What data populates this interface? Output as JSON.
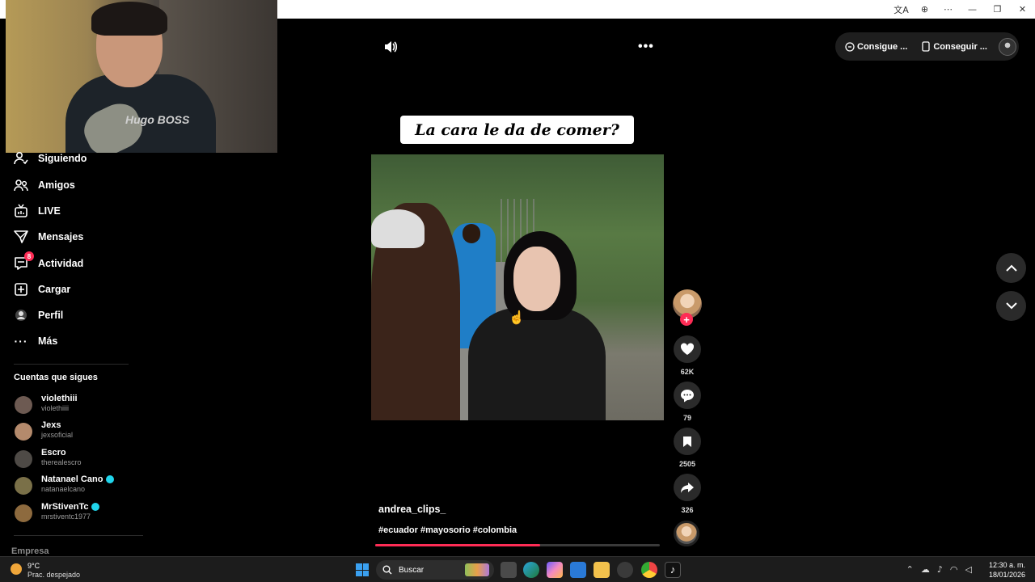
{
  "titlebar": {
    "icons": [
      "translate-icon",
      "zoom-icon",
      "more-icon",
      "minimize-icon",
      "restore-icon",
      "close-icon"
    ],
    "glyphs": [
      "a​A",
      "⊕",
      "⋯",
      "—",
      "❐",
      "✕"
    ]
  },
  "webcam": {
    "shirt_text": "Hugo BOSS"
  },
  "nav": {
    "items": [
      {
        "label": "Siguiendo",
        "icon": "following-icon"
      },
      {
        "label": "Amigos",
        "icon": "friends-icon"
      },
      {
        "label": "LIVE",
        "icon": "live-icon"
      },
      {
        "label": "Mensajes",
        "icon": "messages-icon"
      },
      {
        "label": "Actividad",
        "icon": "activity-icon",
        "badge": "8"
      },
      {
        "label": "Cargar",
        "icon": "upload-icon"
      },
      {
        "label": "Perfil",
        "icon": "profile-icon"
      },
      {
        "label": "Más",
        "icon": "more-icon"
      }
    ]
  },
  "following": {
    "title": "Cuentas que sigues",
    "accounts": [
      {
        "name": "violethiii",
        "handle": "violethiiii",
        "verified": false,
        "color": "#6d5a52"
      },
      {
        "name": "Jexs",
        "handle": "jexsoficial",
        "verified": false,
        "color": "#b48a6c"
      },
      {
        "name": "Escro",
        "handle": "therealescro",
        "verified": false,
        "color": "#4e4a46"
      },
      {
        "name": "Natanael Cano",
        "handle": "natanaelcano",
        "verified": true,
        "color": "#7a7048"
      },
      {
        "name": "MrStivenTc",
        "handle": "mrstiventc1977",
        "verified": true,
        "color": "#8d6a3e"
      }
    ]
  },
  "footer": {
    "empresa": "Empresa"
  },
  "topbar": {
    "get_coins": "Consigue ...",
    "get_app": "Conseguir ..."
  },
  "video": {
    "overlay_caption": "La cara le da de comer?",
    "username": "andrea_clips_",
    "hashtags": "#ecuador #mayosorio #colombia",
    "progress": 0.58
  },
  "actions": {
    "likes": "62K",
    "comments": "79",
    "saves": "2505",
    "shares": "326"
  },
  "taskbar": {
    "weather_temp": "9°C",
    "weather_desc": "Prac. despejado",
    "search_placeholder": "Buscar",
    "time": "12:30 a. m.",
    "date": "18/01/2026"
  },
  "colors": {
    "accent": "#fe2c55",
    "verified": "#20d5ec"
  }
}
